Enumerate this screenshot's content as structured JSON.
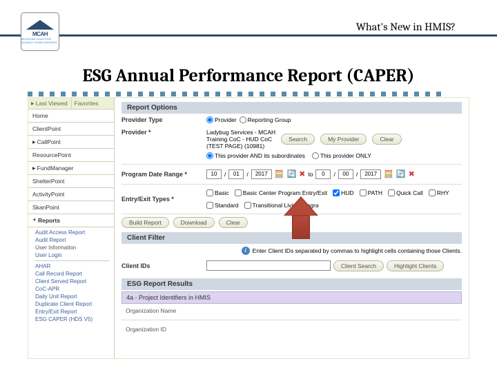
{
  "header": {
    "logo_text": "MCAH",
    "logo_sub": "MICHIGAN COALITION AGAINST HOMELESSNESS",
    "title": "What's New in HMIS?"
  },
  "main_title": "ESG Annual Performance Report (CAPER)",
  "sidebar": {
    "tabs": [
      {
        "label": "Last Viewed"
      },
      {
        "label": "Favorites"
      }
    ],
    "items": [
      {
        "label": "Home"
      },
      {
        "label": "ClientPoint"
      },
      {
        "label": "CallPoint",
        "arrow": true
      },
      {
        "label": "ResourcePoint"
      },
      {
        "label": "FundManager",
        "arrow": true
      },
      {
        "label": "ShelterPoint"
      },
      {
        "label": "ActivityPoint"
      },
      {
        "label": "SkanPoint"
      },
      {
        "label": "Reports",
        "arrow_down": true
      }
    ],
    "reports_a": [
      "Audit Access Report",
      "Audit Report",
      "User Information",
      "User Login"
    ],
    "reports_b": [
      "AHAR",
      "Call Record Report",
      "Client Served Report",
      "CoC-APR",
      "Daily Unit Report",
      "Duplicate Client Report",
      "Entry/Exit Report",
      "ESG CAPER (HDS V5)"
    ]
  },
  "sections": {
    "report_options": "Report Options",
    "client_filter": "Client Filter",
    "esg_results": "ESG Report Results"
  },
  "fields": {
    "provider_type": {
      "label": "Provider Type",
      "opts": [
        "Provider",
        "Reporting Group"
      ]
    },
    "provider": {
      "label": "Provider *",
      "name_line1": "Ladybug Services - MCAH",
      "name_line2": "Training CoC - HUD CoC",
      "name_line3": "(TEST PAGE) (10981)",
      "btns": [
        "Search",
        "My Provider",
        "Clear"
      ],
      "sub_opts": [
        "This provider AND its subordinates",
        "This provider ONLY"
      ]
    },
    "date_range": {
      "label": "Program Date Range *",
      "start": {
        "mm": "10",
        "dd": "01",
        "yyyy": "2017"
      },
      "to": "to",
      "end": {
        "mm": "0",
        "dd": "00",
        "yyyy": "2017"
      }
    },
    "entry_exit": {
      "label": "Entry/Exit Types *",
      "opts": [
        "Basic",
        "Basic Center Program Entry/Exit",
        "HUD",
        "PATH",
        "Quick Call",
        "RHY",
        "Standard",
        "Transitional Living Progra"
      ]
    },
    "build_btns": [
      "Build Report",
      "Download",
      "Clear"
    ],
    "client_info": "Enter Client IDs separated by commas to highlight cells containing those Clients.",
    "client_ids": {
      "label": "Client IDs",
      "btns": [
        "Client Search",
        "Highlight Clients"
      ]
    },
    "result_sub": "4a - Project Identifiers in HMIS",
    "result_fields": [
      "Organization Name",
      "Organization ID"
    ]
  }
}
